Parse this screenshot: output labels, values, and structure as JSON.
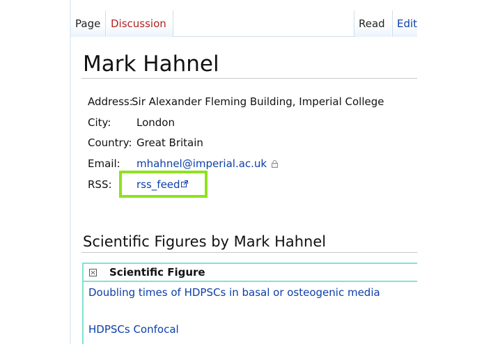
{
  "tabs": {
    "page": "Page",
    "discussion": "Discussion",
    "read": "Read",
    "edit": "Edit"
  },
  "title": "Mark Hahnel",
  "info": {
    "address": {
      "label": "Address:",
      "value": "Sir Alexander Fleming Building, Imperial College"
    },
    "city": {
      "label": "City:",
      "value": "London"
    },
    "country": {
      "label": "Country:",
      "value": "Great Britain"
    },
    "email": {
      "label": "Email:",
      "value": "mhahnel@imperial.ac.uk"
    },
    "rss": {
      "label": "RSS:",
      "value": "rss_feed"
    }
  },
  "section": {
    "title": "Scientific Figures by Mark Hahnel",
    "box_header": "Scientific Figure",
    "figures": [
      "Doubling times of HDPSCs in basal or osteogenic media",
      "HDPSCs Confocal"
    ]
  },
  "colors": {
    "link": "#0b3ea8",
    "discussion_tab": "#b22222",
    "highlight": "#8fe21c",
    "figure_border": "#7fe3d2"
  },
  "icons": {
    "email_lock": "lock-icon",
    "rss_external": "external-link-icon",
    "box_toggle": "collapse-toggle-icon"
  }
}
